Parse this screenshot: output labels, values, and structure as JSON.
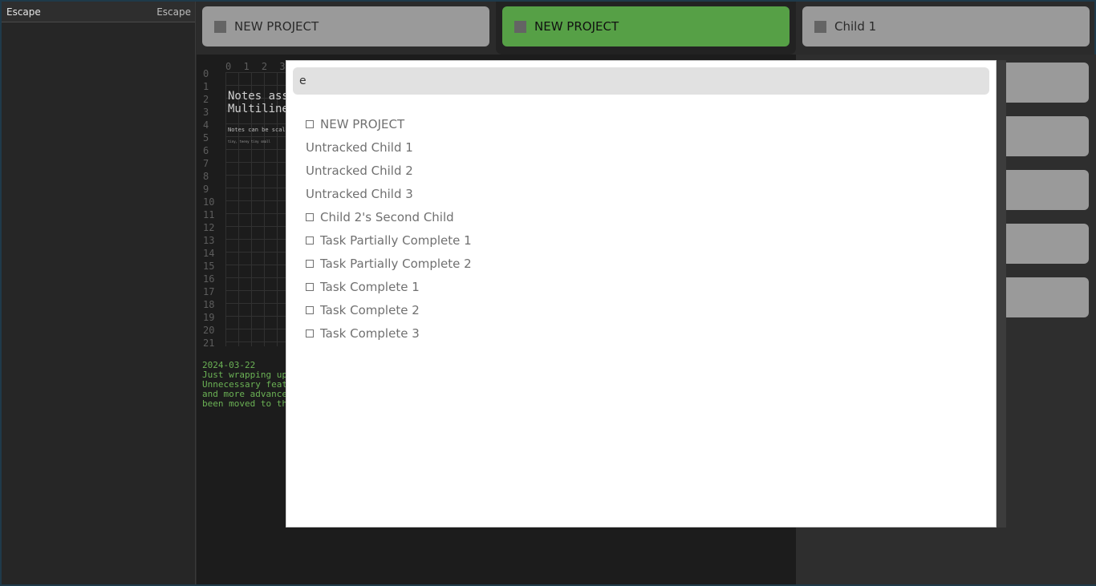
{
  "sidebar": {
    "left_label": "Escape",
    "right_label": "Escape"
  },
  "tabs": [
    {
      "label": "NEW PROJECT",
      "active": false
    },
    {
      "label": "NEW PROJECT",
      "active": true
    },
    {
      "label": "Child 1",
      "active": false
    }
  ],
  "notes": {
    "grid_top": "0 1 2 3 4",
    "row_numbers": [
      "0",
      "1",
      "2",
      "3",
      "4",
      "5",
      "6",
      "7",
      "8",
      "9",
      "10",
      "11",
      "12",
      "13",
      "14",
      "15",
      "16",
      "17",
      "18",
      "19",
      "20",
      "21"
    ],
    "big_text": "Notes ass\nMultiline",
    "small_text": "Notes can be scale",
    "tiny_text": "tiny, teeny tiny small",
    "journal": "2024-03-22\nJust wrapping up t\nUnnecessary featur\nand more advanced \nbeen moved to the"
  },
  "search": {
    "value": "e"
  },
  "results": [
    {
      "label": "NEW PROJECT",
      "checkbox": true
    },
    {
      "label": "Untracked Child 1",
      "checkbox": false
    },
    {
      "label": "Untracked Child 2",
      "checkbox": false
    },
    {
      "label": "Untracked Child 3",
      "checkbox": false
    },
    {
      "label": "Child 2's Second Child",
      "checkbox": true
    },
    {
      "label": "Task Partially Complete 1",
      "checkbox": true
    },
    {
      "label": "Task Partially Complete 2",
      "checkbox": true
    },
    {
      "label": "Task Complete 1",
      "checkbox": true
    },
    {
      "label": "Task Complete 2",
      "checkbox": true
    },
    {
      "label": "Task Complete 3",
      "checkbox": true
    }
  ],
  "colors": {
    "active_tab": "#56a046",
    "journal_text": "#6bb255"
  }
}
